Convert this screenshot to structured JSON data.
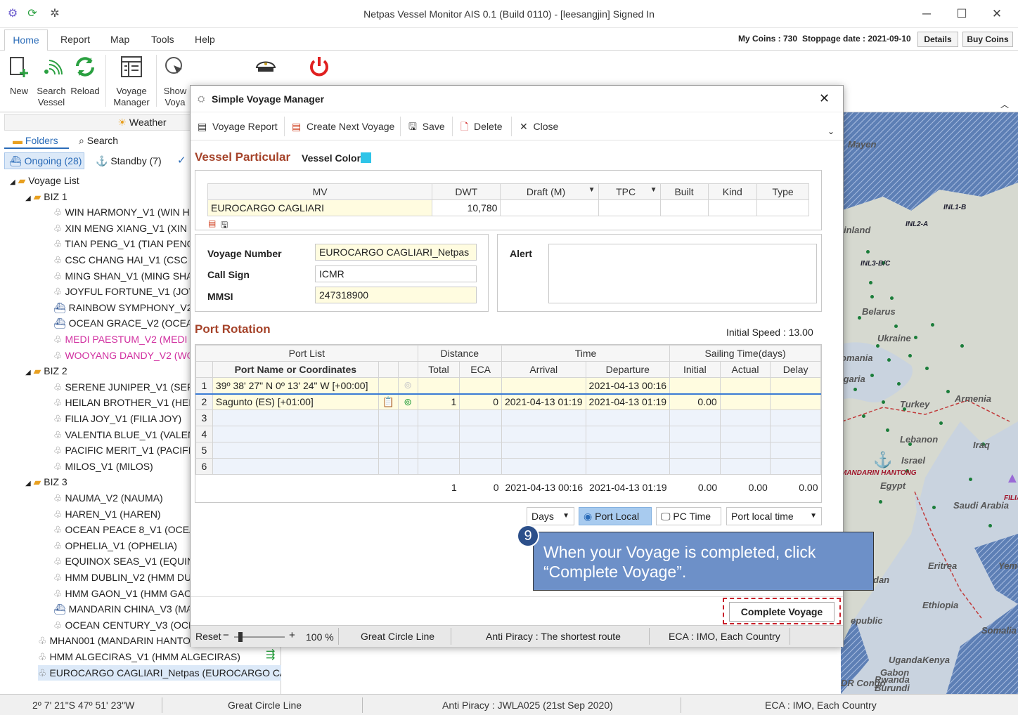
{
  "window": {
    "title": "Netpas Vessel Monitor AIS 0.1 (Build 0110) - [leesangjin] Signed In"
  },
  "menu": {
    "items": [
      "Home",
      "Report",
      "Map",
      "Tools",
      "Help"
    ],
    "coins": "My Coins : 730",
    "stoppage": "Stoppage date : 2021-09-10",
    "details": "Details",
    "buy_coins": "Buy Coins"
  },
  "ribbon": {
    "new": "New",
    "search_vessel_1": "Search",
    "search_vessel_2": "Vessel",
    "reload": "Reload",
    "voyage_manager_1": "Voyage",
    "voyage_manager_2": "Manager",
    "show_1": "Show",
    "show_2": "Voya"
  },
  "left": {
    "weather": "Weather",
    "folders": "Folders",
    "search": "Search",
    "ongoing": "Ongoing (28)",
    "standby": "Standby (7)",
    "voyage_list": "Voyage List",
    "groups": [
      {
        "name": "BIZ 1",
        "items": [
          "WIN HARMONY_V1 (WIN HA",
          "XIN MENG XIANG_V1 (XIN M",
          "TIAN PENG_V1 (TIAN PENG)",
          "CSC CHANG HAI_V1 (CSC CH",
          "MING SHAN_V1 (MING SHA",
          "JOYFUL FORTUNE_V1 (JOYFU",
          "RAINBOW SYMPHONY_V2 (F",
          "OCEAN GRACE_V2 (OCEAN",
          "MEDI PAESTUM_V2 (MEDI PA",
          "WOOYANG DANDY_V2 (WO"
        ]
      },
      {
        "name": "BIZ 2",
        "items": [
          "SERENE JUNIPER_V1 (SEREN",
          "HEILAN BROTHER_V1 (HEILA",
          "FILIA JOY_V1 (FILIA JOY)",
          "VALENTIA BLUE_V1 (VALENT",
          "PACIFIC MERIT_V1 (PACIFIC I",
          "MILOS_V1 (MILOS)"
        ]
      },
      {
        "name": "BIZ 3",
        "items": [
          "NAUMA_V2 (NAUMA)",
          "HAREN_V1 (HAREN)",
          "OCEAN PEACE 8_V1 (OCEAN",
          "OPHELIA_V1 (OPHELIA)",
          "EQUINOX SEAS_V1 (EQUINO",
          "HMM DUBLIN_V2 (HMM DU",
          "HMM GAON_V1 (HMM GAO",
          "MANDARIN CHINA_V3 (MAN",
          "OCEAN CENTURY_V3 (OCEA"
        ]
      }
    ],
    "loose": [
      "MHAN001 (MANDARIN HANTO",
      "HMM ALGECIRAS_V1 (HMM ALGECIRAS)",
      "EUROCARGO CAGLIARI_Netpas (EUROCARGO CAG..."
    ]
  },
  "dialog": {
    "title": "Simple Voyage Manager",
    "toolbar": {
      "voyage_report": "Voyage Report",
      "create_next": "Create Next Voyage",
      "save": "Save",
      "delete": "Delete",
      "close": "Close"
    },
    "vessel_particular": "Vessel Particular",
    "vessel_color_label": "Vessel Color",
    "vessel_color": "#2ec4e8",
    "vp_headers": [
      "MV",
      "DWT",
      "Draft (M)",
      "TPC",
      "Built",
      "Kind",
      "Type"
    ],
    "vp_row": {
      "mv": "EUROCARGO CAGLIARI",
      "dwt": "10,780"
    },
    "voyage_number_label": "Voyage Number",
    "voyage_number": "EUROCARGO CAGLIARI_Netpas",
    "call_sign_label": "Call Sign",
    "call_sign": "ICMR",
    "mmsi_label": "MMSI",
    "mmsi": "247318900",
    "alert_label": "Alert",
    "port_rotation": "Port Rotation",
    "initial_speed": "Initial Speed :  13.00",
    "pr_groups": {
      "port_list": "Port List",
      "distance": "Distance",
      "time": "Time",
      "sailing": "Sailing Time(days)"
    },
    "pr_headers": {
      "port_name": "Port Name or Coordinates",
      "total": "Total",
      "eca": "ECA",
      "arrival": "Arrival",
      "departure": "Departure",
      "initial": "Initial",
      "actual": "Actual",
      "delay": "Delay"
    },
    "rows": [
      {
        "n": "1",
        "port": "39º 38' 27\" N 0º 13' 24\" W [+00:00]",
        "total": "",
        "eca": "",
        "arrival": "",
        "departure": "2021-04-13 00:16",
        "initial": ""
      },
      {
        "n": "2",
        "port": "Sagunto (ES) [+01:00]",
        "total": "1",
        "eca": "0",
        "arrival": "2021-04-13 01:19",
        "departure": "2021-04-13 01:19",
        "initial": "0.00"
      },
      {
        "n": "3"
      },
      {
        "n": "4"
      },
      {
        "n": "5"
      },
      {
        "n": "6"
      }
    ],
    "totals": {
      "total": "1",
      "eca": "0",
      "arrival": "2021-04-13 00:16",
      "departure": "2021-04-13 01:19",
      "initial": "0.00",
      "actual": "0.00",
      "delay": "0.00"
    },
    "footer": {
      "days": "Days",
      "port_local": "Port Local",
      "pc_time": "PC Time",
      "port_local_time": "Port local time"
    },
    "complete_voyage": "Complete Voyage",
    "status": {
      "reset": "Reset",
      "zoom": "100 %",
      "gcl": "Great Circle Line",
      "anti": "Anti Piracy : The shortest route",
      "eca": "ECA : IMO, Each Country"
    }
  },
  "callout": {
    "number": "9",
    "text": "When your Voyage is completed, click “Complete Voyage”."
  },
  "map_labels": [
    "Mayen",
    "INL1-B",
    "INL2-A",
    "inland",
    "INL3-B/C",
    "Belarus",
    "Ukraine",
    "omania",
    "lgaria",
    "Turkey",
    "Armenia",
    "Lebanon",
    "Iraq",
    "Israel",
    "MANDARIN HANTONG",
    "Egypt",
    "FILIA",
    "Saudi Arabia",
    "Eritrea",
    "Yemen",
    "dan",
    "Ethiopia",
    "epublic",
    "Somalia",
    "Uganda",
    "Kenya",
    "Gabon",
    "DR Congo",
    "Rwanda",
    "Burundi"
  ],
  "statusbar": {
    "coord": "2º 7' 21\"S 47º 51' 23\"W",
    "gcl": "Great Circle Line",
    "anti": "Anti Piracy : JWLA025 (21st Sep 2020)",
    "eca": "ECA : IMO, Each Country"
  }
}
